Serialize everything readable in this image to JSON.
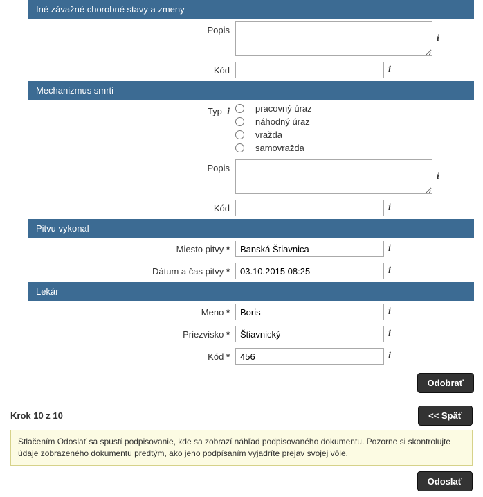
{
  "sections": {
    "ine": {
      "title": "Iné závažné chorobné stavy a zmeny"
    },
    "mechanizmus": {
      "title": "Mechanizmus smrti"
    },
    "pitvu": {
      "title": "Pitvu vykonal"
    },
    "lekar": {
      "title": "Lekár"
    }
  },
  "labels": {
    "popis": "Popis",
    "kod": "Kód",
    "typ": "Typ",
    "miesto_pitvy": "Miesto pitvy",
    "datum_cas_pitvy": "Dátum a čas pitvy",
    "meno": "Meno",
    "priezvisko": "Priezvisko",
    "star": "*"
  },
  "radio_options": {
    "pracovny_uraz": "pracovný úraz",
    "nahodny_uraz": "náhodný úraz",
    "vrazda": "vražda",
    "samovrazda": "samovražda"
  },
  "values": {
    "ine_popis": "",
    "ine_kod": "",
    "mech_popis": "",
    "mech_kod": "",
    "miesto_pitvy": "Banská Štiavnica",
    "datum_cas_pitvy": "03.10.2015 08:25",
    "meno": "Boris",
    "priezvisko": "Štiavnický",
    "lekar_kod": "456"
  },
  "buttons": {
    "odobrat": "Odobrať",
    "spat": "<< Späť",
    "odoslat": "Odoslať"
  },
  "step": "Krok 10 z 10",
  "notice": "Stlačením Odoslať sa spustí podpisovanie, kde sa zobrazí náhľad podpisovaného dokumentu. Pozorne si skontrolujte údaje zobrazeného dokumentu predtým, ako jeho podpísaním vyjadríte prejav svojej vôle."
}
